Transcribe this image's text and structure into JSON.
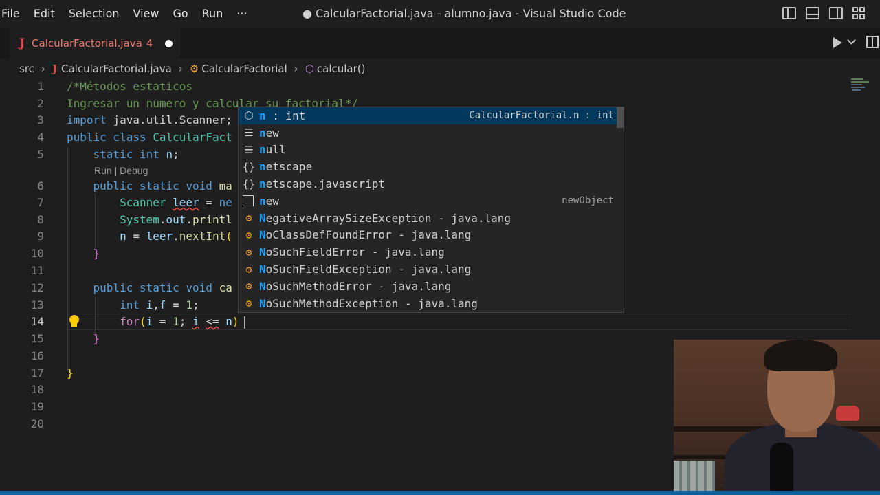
{
  "menu": [
    "File",
    "Edit",
    "Selection",
    "View",
    "Go",
    "Run",
    "···"
  ],
  "window_title": "● CalcularFactorial.java - alumno.java - Visual Studio Code",
  "tab": {
    "icon": "J",
    "label": "CalcularFactorial.java",
    "problems": "4"
  },
  "breadcrumb": {
    "folder": "src",
    "file": "CalcularFactorial.java",
    "class": "CalcularFactorial",
    "method": "calcular()"
  },
  "line_numbers": [
    "1",
    "2",
    "3",
    "4",
    "5",
    "6",
    "7",
    "8",
    "9",
    "10",
    "11",
    "12",
    "13",
    "14",
    "15",
    "16",
    "17",
    "18",
    "19",
    "20"
  ],
  "code": {
    "l1": "/*Métodos estaticos",
    "l2": "Ingresar un numero y calcular su factorial*/",
    "l3_kw": "import",
    "l3_rest": " java.util.Scanner;",
    "l4_kw1": "public",
    "l4_kw2": "class",
    "l4_name": "CalcularFact",
    "l5_kw1": "static",
    "l5_kw2": "int",
    "l5_var": "n",
    "codelens": "Run | Debug",
    "l6_kw1": "public",
    "l6_kw2": "static",
    "l6_kw3": "void",
    "l6_fn": "ma",
    "l7_type": "Scanner",
    "l7_var": "leer",
    "l7_rest": "ne",
    "l8_type": "System",
    "l8_var": "out",
    "l8_fn": "printl",
    "l9_var1": "n",
    "l9_var2": "leer",
    "l9_fn": "nextInt",
    "l12_kw1": "public",
    "l12_kw2": "static",
    "l12_kw3": "void",
    "l12_fn": "ca",
    "l13_kw": "int",
    "l13_var1": "i",
    "l13_var2": "f",
    "l13_num": "1",
    "l14_kw": "for",
    "l14_var1": "i",
    "l14_num": "1",
    "l14_var2": "i",
    "l14_op": "<=",
    "l14_var3": "n"
  },
  "suggestions": [
    {
      "icon": "field-icon",
      "match": "n",
      "rest": " : int",
      "detail": "CalcularFactorial.n : int"
    },
    {
      "icon": "keyword-icon",
      "match": "n",
      "rest": "ew",
      "detail": ""
    },
    {
      "icon": "keyword-icon",
      "match": "n",
      "rest": "ull",
      "detail": ""
    },
    {
      "icon": "module-icon",
      "match": "n",
      "rest": "etscape",
      "detail": ""
    },
    {
      "icon": "module-icon",
      "match": "n",
      "rest": "etscape.javascript",
      "detail": ""
    },
    {
      "icon": "snippet-icon",
      "match": "n",
      "rest": "ew",
      "detail": "newObject"
    },
    {
      "icon": "class-icon",
      "match": "N",
      "rest": "egativeArraySizeException - java.lang",
      "detail": ""
    },
    {
      "icon": "class-icon",
      "match": "N",
      "rest": "oClassDefFoundError - java.lang",
      "detail": ""
    },
    {
      "icon": "class-icon",
      "match": "N",
      "rest": "oSuchFieldError - java.lang",
      "detail": ""
    },
    {
      "icon": "class-icon",
      "match": "N",
      "rest": "oSuchFieldException - java.lang",
      "detail": ""
    },
    {
      "icon": "class-icon",
      "match": "N",
      "rest": "oSuchMethodError - java.lang",
      "detail": ""
    },
    {
      "icon": "class-icon",
      "match": "N",
      "rest": "oSuchMethodException - java.lang",
      "detail": ""
    }
  ],
  "colors": {
    "accent": "#0e639c",
    "selected_row": "#04395e",
    "match_highlight": "#18a3ff",
    "tab_modified": "#f07a72"
  }
}
